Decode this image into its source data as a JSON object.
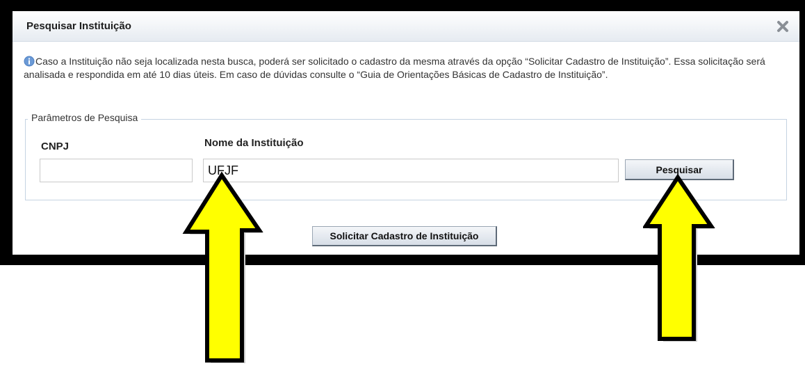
{
  "dialog": {
    "title": "Pesquisar Instituição",
    "close_icon": "close-icon",
    "info_icon": "info-icon",
    "info_text": "Caso a Instituição não seja localizada nesta busca, poderá ser solicitado o cadastro da mesma através da opção “Solicitar Cadastro de Instituição”. Essa solicitação será analisada e respondida em até 10 dias úteis. Em caso de dúvidas consulte o “Guia de Orientações Básicas de Cadastro de Instituição”."
  },
  "search": {
    "legend": "Parâmetros de Pesquisa",
    "cnpj_label": "CNPJ",
    "cnpj_value": "",
    "name_label": "Nome da Instituição",
    "name_value": "UFJF",
    "search_button": "Pesquisar"
  },
  "footer": {
    "request_button": "Solicitar Cadastro de Instituição"
  },
  "annotations": {
    "arrow_color": "#ffff00",
    "arrow_outline": "#000000"
  }
}
